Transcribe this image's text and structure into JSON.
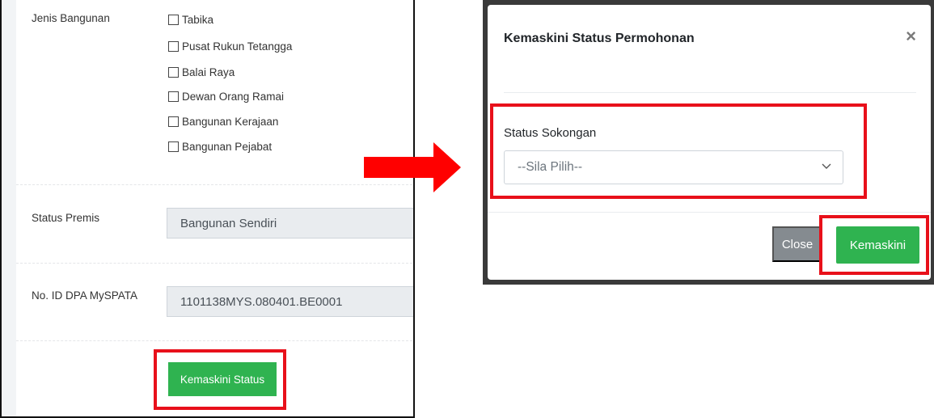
{
  "form": {
    "jenis_bangunan_label": "Jenis Bangunan",
    "options": [
      "Tabika",
      "Pusat Rukun Tetangga",
      "Balai Raya",
      "Dewan Orang Ramai",
      "Bangunan Kerajaan",
      "Bangunan Pejabat"
    ],
    "status_premis_label": "Status Premis",
    "status_premis_value": "Bangunan Sendiri",
    "dpa_label": "No. ID DPA MySPATA",
    "dpa_value": "1101138MYS.080401.BE0001",
    "update_button": "Kemaskini Status"
  },
  "modal": {
    "title": "Kemaskini Status Permohonan",
    "close_symbol": "×",
    "status_label": "Status Sokongan",
    "select_placeholder": "--Sila Pilih--",
    "close_button": "Close",
    "submit_button": "Kemaskini"
  },
  "colors": {
    "highlight": "#e8101a",
    "arrow": "#ff0000",
    "success": "#2fb350",
    "secondary": "#858b90"
  },
  "icons": {
    "arrow": "arrow-right-icon",
    "dropdown": "chevron-down-icon",
    "close": "close-icon"
  }
}
